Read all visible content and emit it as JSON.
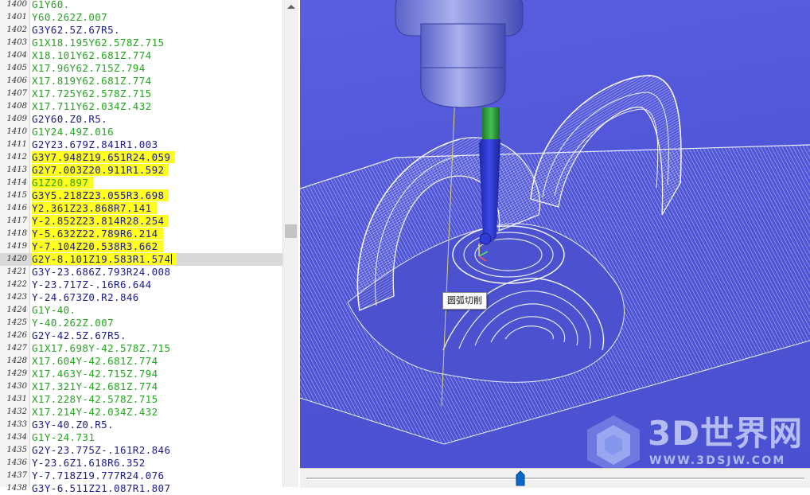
{
  "editor": {
    "lines": [
      {
        "n": "1400",
        "code": "G1Y60.",
        "color": "green",
        "hl": false
      },
      {
        "n": "1401",
        "code": "Y60.262Z.007",
        "color": "green",
        "hl": false
      },
      {
        "n": "1402",
        "code": "G3Y62.5Z.67R5.",
        "color": "navy",
        "hl": false
      },
      {
        "n": "1403",
        "code": "G1X18.195Y62.578Z.715",
        "color": "green",
        "hl": false
      },
      {
        "n": "1404",
        "code": "X18.101Y62.681Z.774",
        "color": "green",
        "hl": false
      },
      {
        "n": "1405",
        "code": "X17.96Y62.715Z.794",
        "color": "green",
        "hl": false
      },
      {
        "n": "1406",
        "code": "X17.819Y62.681Z.774",
        "color": "green",
        "hl": false
      },
      {
        "n": "1407",
        "code": "X17.725Y62.578Z.715",
        "color": "green",
        "hl": false
      },
      {
        "n": "1408",
        "code": "X17.711Y62.034Z.432",
        "color": "green",
        "hl": false
      },
      {
        "n": "1409",
        "code": "G2Y60.Z0.R5.",
        "color": "navy",
        "hl": false
      },
      {
        "n": "1410",
        "code": "G1Y24.49Z.016",
        "color": "green",
        "hl": false
      },
      {
        "n": "1411",
        "code": "G2Y23.679Z.841R1.003",
        "color": "navy",
        "hl": false
      },
      {
        "n": "1412",
        "code": "G3Y7.948Z19.651R24.059",
        "color": "navy",
        "hl": true
      },
      {
        "n": "1413",
        "code": "G2Y7.003Z20.911R1.592",
        "color": "navy",
        "hl": true
      },
      {
        "n": "1414",
        "code": "G1Z20.897",
        "color": "green",
        "hl": true
      },
      {
        "n": "1415",
        "code": "G3Y5.218Z23.055R3.698",
        "color": "navy",
        "hl": true
      },
      {
        "n": "1416",
        "code": "Y2.361Z23.868R7.141",
        "color": "navy",
        "hl": true
      },
      {
        "n": "1417",
        "code": "Y-2.852Z23.814R28.254",
        "color": "navy",
        "hl": true
      },
      {
        "n": "1418",
        "code": "Y-5.632Z22.789R6.214",
        "color": "navy",
        "hl": true
      },
      {
        "n": "1419",
        "code": "Y-7.104Z20.538R3.662",
        "color": "navy",
        "hl": true
      },
      {
        "n": "1420",
        "code": "G2Y-8.101Z19.583R1.574",
        "color": "navy",
        "hl": true,
        "current": true
      },
      {
        "n": "1421",
        "code": "G3Y-23.686Z.793R24.008",
        "color": "navy",
        "hl": false
      },
      {
        "n": "1422",
        "code": "Y-23.717Z-.16R6.644",
        "color": "navy",
        "hl": false
      },
      {
        "n": "1423",
        "code": "Y-24.673Z0.R2.846",
        "color": "navy",
        "hl": false
      },
      {
        "n": "1424",
        "code": "G1Y-40.",
        "color": "green",
        "hl": false
      },
      {
        "n": "1425",
        "code": "Y-40.262Z.007",
        "color": "green",
        "hl": false
      },
      {
        "n": "1426",
        "code": "G2Y-42.5Z.67R5.",
        "color": "navy",
        "hl": false
      },
      {
        "n": "1427",
        "code": "G1X17.698Y-42.578Z.715",
        "color": "green",
        "hl": false
      },
      {
        "n": "1428",
        "code": "X17.604Y-42.681Z.774",
        "color": "green",
        "hl": false
      },
      {
        "n": "1429",
        "code": "X17.463Y-42.715Z.794",
        "color": "green",
        "hl": false
      },
      {
        "n": "1430",
        "code": "X17.321Y-42.681Z.774",
        "color": "green",
        "hl": false
      },
      {
        "n": "1431",
        "code": "X17.228Y-42.578Z.715",
        "color": "green",
        "hl": false
      },
      {
        "n": "1432",
        "code": "X17.214Y-42.034Z.432",
        "color": "green",
        "hl": false
      },
      {
        "n": "1433",
        "code": "G3Y-40.Z0.R5.",
        "color": "navy",
        "hl": false
      },
      {
        "n": "1434",
        "code": "G1Y-24.731",
        "color": "green",
        "hl": false
      },
      {
        "n": "1435",
        "code": "G2Y-23.775Z-.161R2.846",
        "color": "navy",
        "hl": false
      },
      {
        "n": "1436",
        "code": "Y-23.6Z1.618R6.352",
        "color": "navy",
        "hl": false
      },
      {
        "n": "1437",
        "code": "Y-7.718Z19.777R24.076",
        "color": "navy",
        "hl": false
      },
      {
        "n": "1438",
        "code": "G3Y-6.511Z21.087R1.807",
        "color": "navy",
        "hl": false
      }
    ]
  },
  "viewport": {
    "tooltip": "圆弧切削",
    "watermark_title": "3D世界网",
    "watermark_url": "WWW.3DSJW.COM"
  },
  "slider": {
    "position_fraction": 0.43
  },
  "colors": {
    "code_green": "#22a81e",
    "code_navy": "#1b1b8e",
    "highlight": "#ffff1e",
    "viewport_bg": "#5057d8",
    "toolpath": "#e6e8ff",
    "tool_shank": "#2c36c8",
    "tool_collar": "#2e9a38"
  },
  "icons": [
    "scroll-up-arrow-icon",
    "slider-thumb-icon",
    "axis-triad-icon",
    "3dsjw-logo-icon"
  ]
}
